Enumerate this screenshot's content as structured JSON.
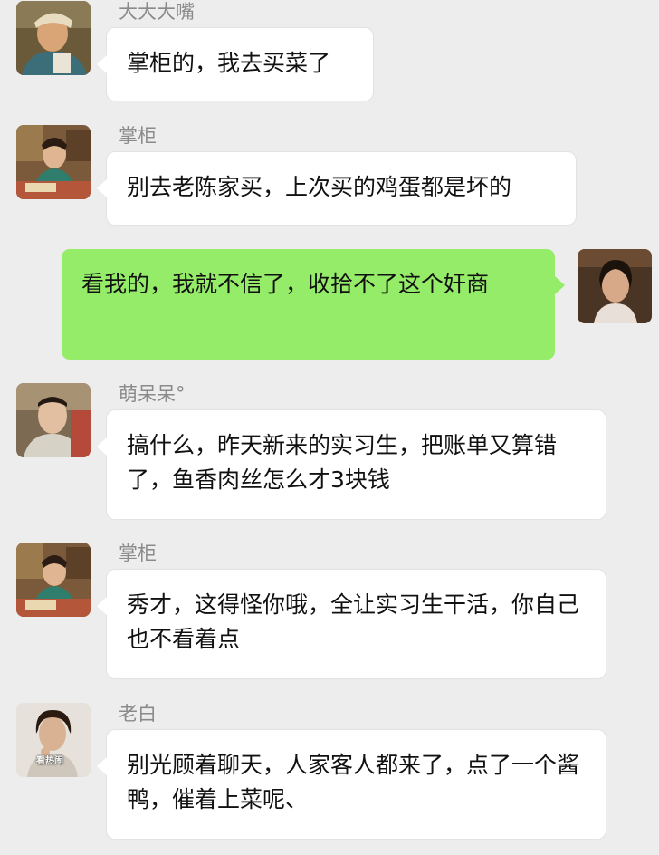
{
  "messages": [
    {
      "sender": "大大大嘴",
      "text": "掌柜的，我去买菜了",
      "avatar": "chef-avatar"
    },
    {
      "sender": "掌柜",
      "text": "别去老陈家买，上次买的鸡蛋都是坏的",
      "avatar": "innkeeper-avatar"
    },
    {
      "sender": "",
      "text": "看我的，我就不信了，收拾不了这个奸商",
      "avatar": "self-avatar"
    },
    {
      "sender": "萌呆呆°",
      "text": "搞什么，昨天新来的实习生，把账单又算错了，鱼香肉丝怎么才3块钱",
      "avatar": "scholar-avatar"
    },
    {
      "sender": "掌柜",
      "text": "秀才，这得怪你哦，全让实习生干活，你自己也不看着点",
      "avatar": "innkeeper-avatar"
    },
    {
      "sender": "老白",
      "text": "别光顾着聊天，人家客人都来了，点了一个酱鸭，催着上菜呢、",
      "avatar": "waiter-avatar",
      "avatar_caption": "看热闹"
    }
  ],
  "colors": {
    "background": "#ededed",
    "incoming_bubble": "#ffffff",
    "outgoing_bubble": "#95ec69",
    "sender_name": "#8a8a8a"
  }
}
